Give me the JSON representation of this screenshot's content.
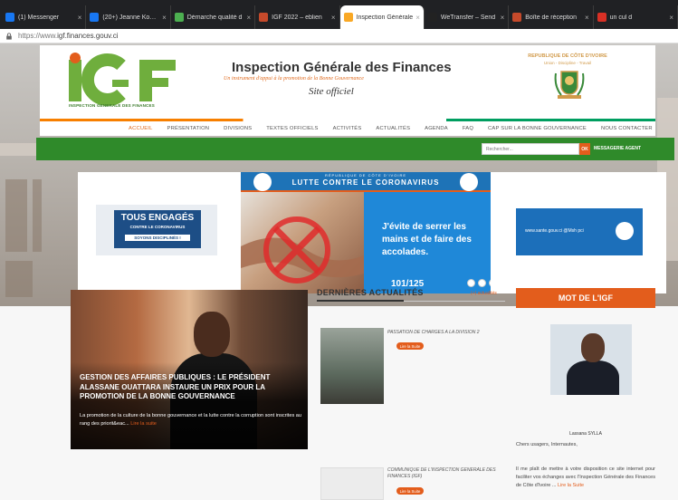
{
  "browser": {
    "tabs": [
      {
        "label": "(1) Messenger",
        "color": "#1877f2",
        "active": false
      },
      {
        "label": "(20+) Jeanne Kouass",
        "color": "#1877f2",
        "active": false
      },
      {
        "label": "Démarche qualité d",
        "color": "#4caf50",
        "active": false
      },
      {
        "label": "IGF 2022 – eblien",
        "color": "#c64a2b",
        "active": false
      },
      {
        "label": "Inspection Générale",
        "color": "#f9a825",
        "active": true
      },
      {
        "label": "WeTransfer – Send",
        "color": "#222222",
        "active": false
      },
      {
        "label": "Boîte de réception",
        "color": "#c64a2b",
        "active": false
      },
      {
        "label": "un cul d",
        "color": "#d93025",
        "active": false
      }
    ],
    "url_scheme": "https://www.",
    "url_host": "igf.finances.gouv.ci"
  },
  "header": {
    "logo_sub": "INSPECTION GENERALE DES FINANCES",
    "title": "Inspection Générale des Finances",
    "tagline": "Un instrument d'appui à la promotion de la Bonne Gouvernance",
    "official": "Site officiel",
    "republic": "REPUBLIQUE DE CÔTE D'IVOIRE",
    "republic_motto": "Union - Discipline - Travail"
  },
  "menu": {
    "items": [
      "Accueil",
      "Présentation",
      "Divisions",
      "Textes officiels",
      "Activités",
      "Actualités",
      "Agenda",
      "FAQ",
      "Cap sur la bonne gouvernance",
      "Nous contacter"
    ]
  },
  "greenbar": {
    "search_placeholder": "Rechercher...",
    "search_button": "OK",
    "agent_link": "MESSAGERIE AGENT"
  },
  "banner": {
    "left_title": "TOUS ENGAGÉS",
    "left_sub": "CONTRE LE CORONAVIRUS",
    "left_tag": "SOYONS DISCIPLINÉS !",
    "corona_rep": "RÉPUBLIQUE DE CÔTE D'IVOIRE",
    "corona_title": "LUTTE CONTRE LE CORONAVIRUS",
    "corona_msg": "J'évite de serrer les mains et de faire des accolades.",
    "corona_num": "101/125",
    "right_url": "www.sante.gouv.ci  @Msh pci",
    "slide_count": 8,
    "active_slide": 6
  },
  "feature": {
    "headline": "GESTION DES AFFAIRES PUBLIQUES : LE PRÉSIDENT ALASSANE OUATTARA INSTAURE UN PRIX POUR LA PROMOTION DE LA BONNE GOUVERNANCE",
    "excerpt": "La promotion de la culture de la bonne gouvernance et la lutte contre la corruption sont inscrites au rang des priorit&eac...",
    "more": "Lire la suite"
  },
  "news": {
    "title": "DERNIÈRES ACTUALITÉS",
    "all_link": "(+) actualités",
    "items": [
      {
        "title": "PASSATION DE CHARGES A LA DIVISION 2",
        "button": "Lire la Suite"
      },
      {
        "title": "COMMUNIQUE DE L'INSPECTION GENERALE DES FINANCES (IGF)",
        "button": "Lire la Suite"
      }
    ]
  },
  "mot": {
    "title": "MOT DE L'IGF",
    "name": "Lassana SYLLA",
    "greeting": "Chers usagers, Internautes,",
    "text": "Il me plaît de mettre à votre disposition ce site internet pour faciliter vos échanges avec l'Inspection Générale des Finances de Côte d'Ivoire ...",
    "more": "Lire la Suite"
  },
  "colors": {
    "accent": "#e35d1c",
    "green": "#2f8a2a",
    "blue": "#1f88d8"
  }
}
